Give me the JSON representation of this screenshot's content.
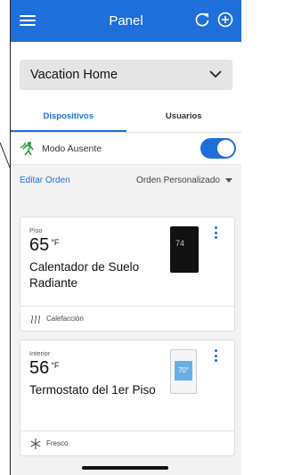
{
  "header": {
    "title": "Panel"
  },
  "location": {
    "selected": "Vacation Home"
  },
  "tabs": [
    {
      "label": "Dispositivos"
    },
    {
      "label": "Usuarios"
    }
  ],
  "away_mode": {
    "label": "Modo Ausente",
    "enabled": true
  },
  "order": {
    "edit_label": "Editar Orden",
    "sort_label": "Orden Personalizado"
  },
  "devices": [
    {
      "location": "Piso",
      "temperature": "65",
      "unit": "°F",
      "name": "Calentador de Suelo Radiante",
      "mode": "Calefacción",
      "thumb_reading": "74"
    },
    {
      "location": "Interior",
      "temperature": "56",
      "unit": "°F",
      "name": "Termostato del 1er Piso",
      "mode": "Fresco",
      "thumb_reading": "70°"
    }
  ],
  "colors": {
    "accent": "#1e6fd9",
    "background": "#f2f2f2"
  },
  "icons": [
    "menu-icon",
    "refresh-icon",
    "add-icon",
    "chevron-down-icon",
    "away-mode-icon",
    "kebab-menu-icon",
    "heat-icon",
    "snowflake-icon"
  ]
}
